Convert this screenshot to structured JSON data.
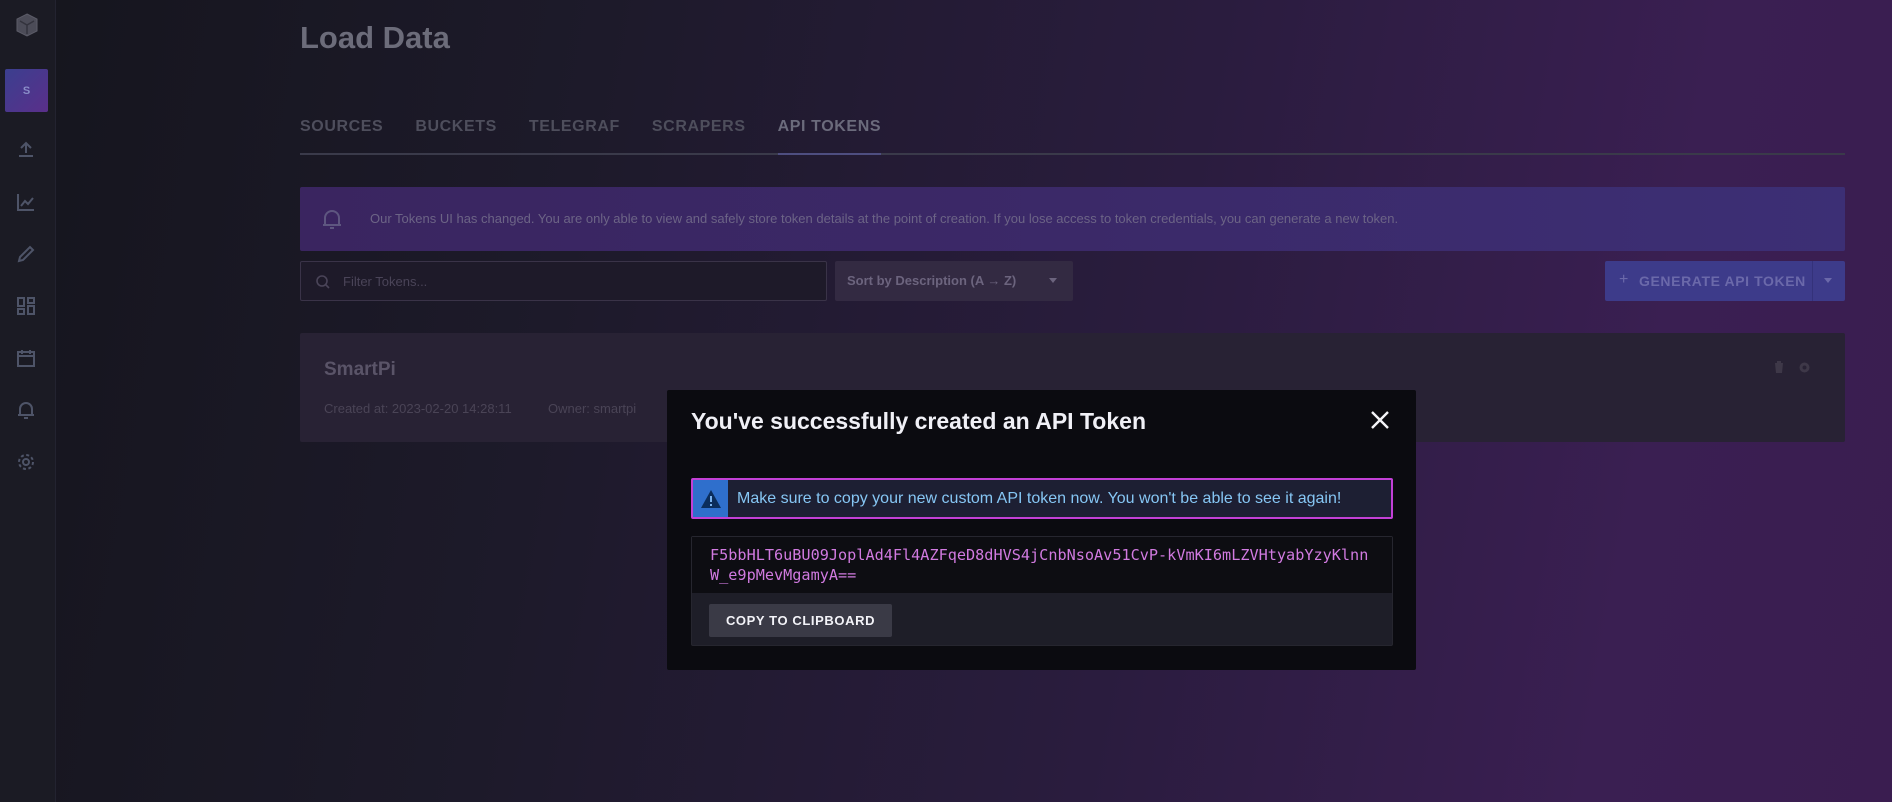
{
  "page": {
    "title": "Load Data"
  },
  "sidebar": {
    "org_initial": "S",
    "icons": [
      "upload-icon",
      "graph-icon",
      "pencil-icon",
      "dashboards-icon",
      "calendar-icon",
      "bell-icon",
      "gear-icon"
    ]
  },
  "tabs": [
    {
      "label": "SOURCES",
      "active": false
    },
    {
      "label": "BUCKETS",
      "active": false
    },
    {
      "label": "TELEGRAF",
      "active": false
    },
    {
      "label": "SCRAPERS",
      "active": false
    },
    {
      "label": "API TOKENS",
      "active": true
    }
  ],
  "notice": {
    "text": "Our Tokens UI has changed. You are only able to view and safely store token details at the point of creation. If you lose access to token credentials, you can generate a new token."
  },
  "toolbar": {
    "filter_placeholder": "Filter Tokens...",
    "sort_label": "Sort by Description (A → Z)",
    "generate_label": "GENERATE API TOKEN"
  },
  "token": {
    "name": "SmartPi",
    "created": "Created at: 2023-02-20 14:28:11",
    "owner": "Owner: smartpi"
  },
  "modal": {
    "title": "You've successfully created an API Token",
    "alert_text": "Make sure to copy your new custom API token now. You won't be able to see it again!",
    "token_value": "F5bbHLT6uBU09JoplAd4Fl4AZFqeD8dHVS4jCnbNsoAv51CvP-kVmKI6mLZVHtyabYzyKlnnW_e9pMevMgamyA==",
    "copy_label": "COPY TO CLIPBOARD"
  },
  "colors": {
    "alert_border": "#c340d6",
    "alert_icon_bg": "#2f6fcc",
    "token_text": "#d17ae0"
  }
}
